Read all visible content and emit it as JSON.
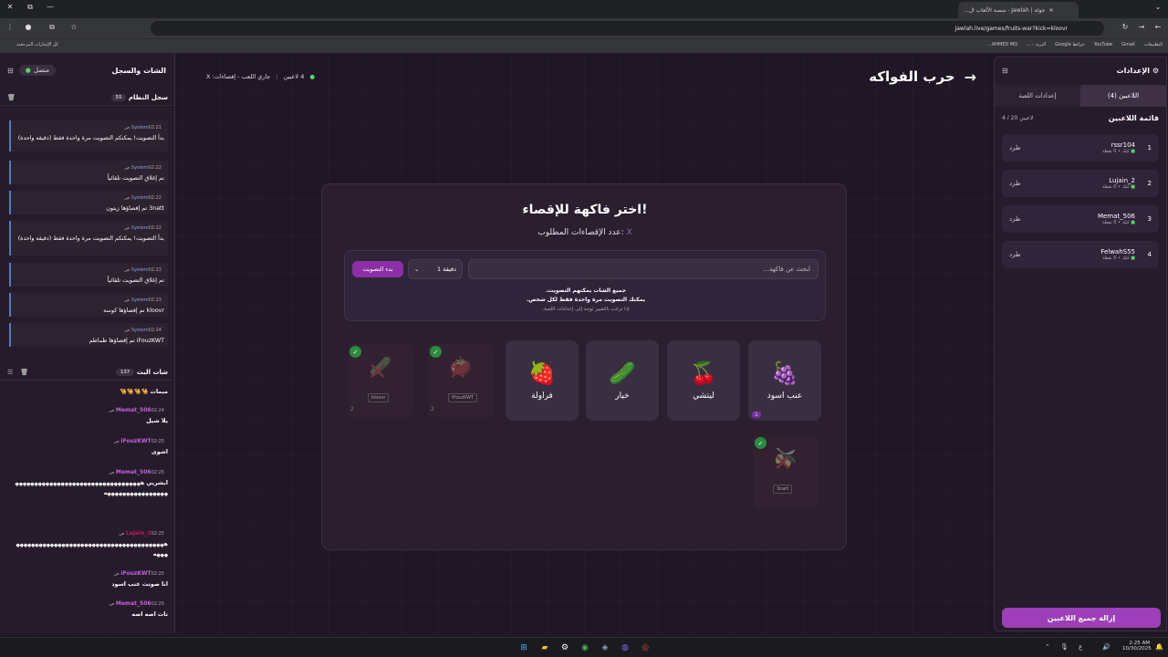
{
  "browser": {
    "tab_title": "جولة | Jawlah - منصة الألعاب ال...",
    "url": "jawlah.live/games/fruits-war?kick=kloovr",
    "bookmarks": [
      "التطبيقات",
      "Gmail",
      "YouTube",
      "خرائط Google",
      "البريد - ...",
      "AHMED MO...",
      "كل الإشارات المرجعية"
    ]
  },
  "chat": {
    "title": "الشات والسجل",
    "status": "متصل",
    "system_log": {
      "title": "سجل النظام",
      "count": "55"
    },
    "system_messages": [
      {
        "sender": "System",
        "time": "02:21 ص",
        "text": "بدأ التصويت! يمكنكم التصويت مرة واحدة فقط (دقيقة واحدة)"
      },
      {
        "sender": "System",
        "time": "02:22 ص",
        "text": "تم إغلاق التصويت تلقائياً"
      },
      {
        "sender": "System",
        "time": "02:22 ص",
        "text": "3natt تم إقصاؤها زيتون"
      },
      {
        "sender": "System",
        "time": "02:22 ص",
        "text": "بدأ التصويت! يمكنكم التصويت مرة واحدة فقط (دقيقة واحدة)"
      },
      {
        "sender": "System",
        "time": "02:23 ص",
        "text": "تم إغلاق التصويت تلقائياً"
      },
      {
        "sender": "System",
        "time": "02:23 ص",
        "text": "kloovr تم إقصاؤها كوسة"
      },
      {
        "sender": "System",
        "time": "02:24 ص",
        "text": "iFouzKWT تم إقصاؤها طماطم"
      }
    ],
    "live_chat": {
      "title": "شات البث",
      "count": "137"
    },
    "live_messages": [
      {
        "name": "",
        "time": "",
        "text": "ميمات 🐪🐪🐪🐪",
        "color": "#fff"
      },
      {
        "name": "Memat_506",
        "time": "02:24 ص",
        "text": "يلا شيل",
        "color": "#c75fe0"
      },
      {
        "name": "iFouzKWT",
        "time": "02:25 ص",
        "text": "اشوى",
        "color": "#c75fe0"
      },
      {
        "name": "Memat_506",
        "time": "02:25 ص",
        "text": "ابشريي ههههههههههههههههههههههههههههههههههههههههههههههههههه",
        "color": "#c75fe0"
      },
      {
        "name": "Lujain_2",
        "time": "02:25 ص",
        "text": "هههههههههههههههههههههههههههههههههههههههههههه",
        "color": "#c2185b"
      },
      {
        "name": "iFouzKWT",
        "time": "02:25 ص",
        "text": "انا صوتت عنب اسود",
        "color": "#c75fe0"
      },
      {
        "name": "Memat_506",
        "time": "02:25 ص",
        "text": "تات اصه اصه",
        "color": "#c75fe0"
      }
    ]
  },
  "game": {
    "title": "حرب الفواكه",
    "players_online": "4 لاعبين",
    "status_text": "جاري اللعب - إقصاءات: X",
    "heading": "اختر فاكهة للإقصاء!",
    "subheading": "عدد الإقصاءات المطلوب:",
    "subheading_value": "X",
    "search_placeholder": "ابحث عن فاكهة...",
    "duration": "1 دقيقة",
    "start_button": "بدء التصويت",
    "note_line1": "جميع الشات يمكنهم التصويت.",
    "note_line2": "يمكنك التصويت مرة واحدة فقط لكل شخص.",
    "note_line3": "إذا ترغب بالتغيير توجه إلى إعدادات اللعبة.",
    "fruits": [
      {
        "label": "عنب اسود",
        "emoji": "🍇",
        "votes": "1"
      },
      {
        "label": "ليتشي",
        "emoji": "🍒"
      },
      {
        "label": "خيار",
        "emoji": "🥒"
      },
      {
        "label": "فراولة",
        "emoji": "🍓"
      }
    ],
    "eliminated": [
      {
        "label": "طماطم",
        "emoji": "🍅",
        "by": "iFouzKWT",
        "votes": "2"
      },
      {
        "label": "كوسة",
        "emoji": "🥒",
        "by": "kloovr",
        "votes": "2"
      },
      {
        "label": "زيتون",
        "emoji": "🫒",
        "by": "3natt",
        "votes": ""
      }
    ]
  },
  "settings": {
    "title": "الإعدادات",
    "tab_players": "اللاعبين (4)",
    "tab_game": "إعدادات اللعبة",
    "list_title": "قائمة اللاعبين",
    "list_count": "4 / 20 لاعبين",
    "players": [
      {
        "num": "1",
        "name": "rssr104",
        "sub": "كيك • 0 نقطة",
        "kick": "طرد"
      },
      {
        "num": "2",
        "name": "Lujain_2",
        "sub": "كيك • 0 نقطة",
        "kick": "طرد"
      },
      {
        "num": "3",
        "name": "Memat_506",
        "sub": "كيك • 0 نقطة",
        "kick": "طرد"
      },
      {
        "num": "4",
        "name": "FelwahS55",
        "sub": "كيك • 0 نقطة",
        "kick": "طرد"
      }
    ],
    "remove_all": "إزالة جميع اللاعبين"
  },
  "taskbar": {
    "time": "2:25 AM",
    "date": "10/30/2025",
    "lang": "ع"
  }
}
